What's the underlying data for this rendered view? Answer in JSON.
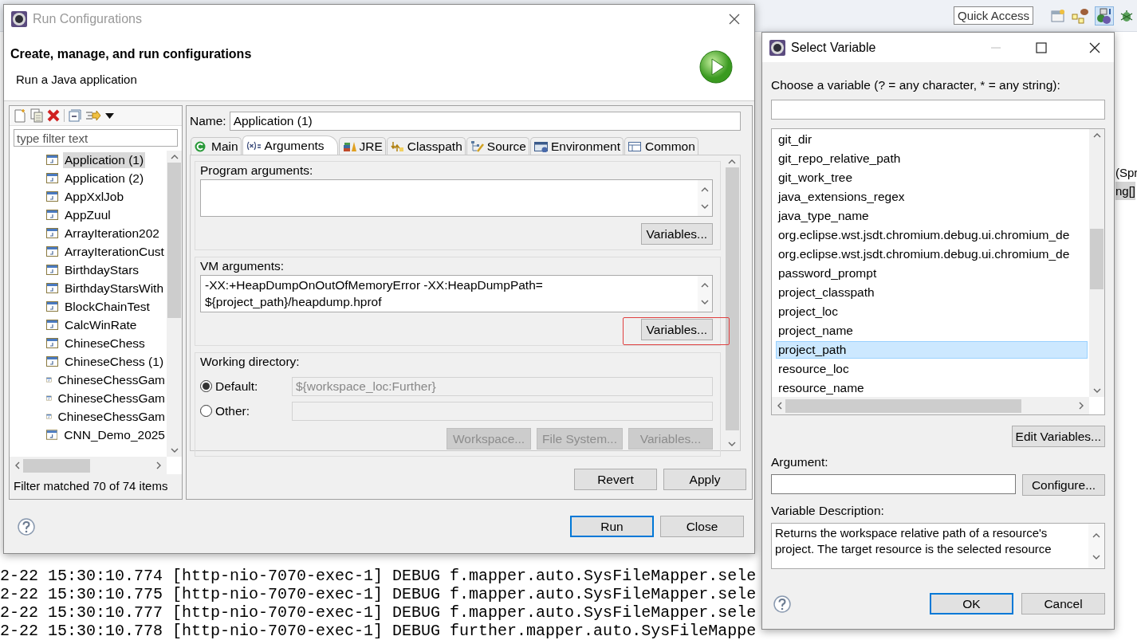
{
  "ide": {
    "quick_access": "Quick Access",
    "editor_fragments": [
      {
        "text": "(Spr",
        "selected": false
      },
      {
        "text": "ng[]",
        "selected": true
      }
    ],
    "console_lines": [
      "2-22 15:30:10.774 [http-nio-7070-exec-1] DEBUG f.mapper.auto.SysFileMapper.sele",
      "2-22 15:30:10.775 [http-nio-7070-exec-1] DEBUG f.mapper.auto.SysFileMapper.sele",
      "2-22 15:30:10.777 [http-nio-7070-exec-1] DEBUG f.mapper.auto.SysFileMapper.sele",
      "2-22 15:30:10.778 [http-nio-7070-exec-1] DEBUG further.mapper.auto.SysFileMappe"
    ]
  },
  "run_dialog": {
    "title": "Run Configurations",
    "heading": "Create, manage, and run configurations",
    "subtitle": "Run a Java application",
    "filter": {
      "placeholder": "type filter text"
    },
    "configs": [
      {
        "label": "Application (1)",
        "selected": true
      },
      {
        "label": "Application (2)",
        "selected": false
      },
      {
        "label": "AppXxlJob",
        "selected": false
      },
      {
        "label": "AppZuul",
        "selected": false
      },
      {
        "label": "ArrayIteration202",
        "selected": false
      },
      {
        "label": "ArrayIterationCust",
        "selected": false
      },
      {
        "label": "BirthdayStars",
        "selected": false
      },
      {
        "label": "BirthdayStarsWith",
        "selected": false
      },
      {
        "label": "BlockChainTest",
        "selected": false
      },
      {
        "label": "CalcWinRate",
        "selected": false
      },
      {
        "label": "ChineseChess",
        "selected": false
      },
      {
        "label": "ChineseChess (1)",
        "selected": false
      },
      {
        "label": "ChineseChessGam",
        "selected": false
      },
      {
        "label": "ChineseChessGam",
        "selected": false
      },
      {
        "label": "ChineseChessGam",
        "selected": false
      },
      {
        "label": "CNN_Demo_2025",
        "selected": false
      }
    ],
    "filter_status": "Filter matched 70 of 74 items",
    "name_label": "Name:",
    "name_value": "Application (1)",
    "tabs": [
      {
        "label": "Main",
        "kind": "main",
        "selected": false
      },
      {
        "label": "Arguments",
        "kind": "arguments",
        "selected": true
      },
      {
        "label": "JRE",
        "kind": "jre",
        "selected": false
      },
      {
        "label": "Classpath",
        "kind": "classpath",
        "selected": false
      },
      {
        "label": "Source",
        "kind": "source",
        "selected": false
      },
      {
        "label": "Environment",
        "kind": "environment",
        "selected": false
      },
      {
        "label": "Common",
        "kind": "common",
        "selected": false
      }
    ],
    "program_arguments": {
      "label": "Program arguments:",
      "button": {
        "label": "Variables...",
        "highlighted": false
      }
    },
    "vm_arguments": {
      "label": "VM arguments:",
      "value_lines": [
        "-XX:+HeapDumpOnOutOfMemoryError -XX:HeapDumpPath=",
        "${project_path}/heapdump.hprof"
      ],
      "button": {
        "label": "Variables...",
        "highlighted": true
      }
    },
    "working_directory": {
      "label": "Working directory:",
      "options": [
        {
          "label": "Default:",
          "selected": true,
          "value": "${workspace_loc:Further}"
        },
        {
          "label": "Other:",
          "selected": false
        }
      ],
      "buttons": [
        {
          "label": "Workspace...",
          "disabled": true
        },
        {
          "label": "File System...",
          "disabled": true
        },
        {
          "label": "Variables...",
          "disabled": true
        }
      ]
    },
    "actions": [
      {
        "label": "Revert",
        "default": false
      },
      {
        "label": "Apply",
        "default": false
      }
    ],
    "footer_buttons": [
      {
        "label": "Run",
        "default": true
      },
      {
        "label": "Close",
        "default": false
      }
    ]
  },
  "select_dialog": {
    "title": "Select Variable",
    "prompt": "Choose a variable (? = any character, * = any string):",
    "variables": [
      {
        "label": "git_dir",
        "selected": false
      },
      {
        "label": "git_repo_relative_path",
        "selected": false
      },
      {
        "label": "git_work_tree",
        "selected": false
      },
      {
        "label": "java_extensions_regex",
        "selected": false
      },
      {
        "label": "java_type_name",
        "selected": false
      },
      {
        "label": "org.eclipse.wst.jsdt.chromium.debug.ui.chromium_de",
        "selected": false
      },
      {
        "label": "org.eclipse.wst.jsdt.chromium.debug.ui.chromium_de",
        "selected": false
      },
      {
        "label": "password_prompt",
        "selected": false
      },
      {
        "label": "project_classpath",
        "selected": false
      },
      {
        "label": "project_loc",
        "selected": false
      },
      {
        "label": "project_name",
        "selected": false
      },
      {
        "label": "project_path",
        "selected": true
      },
      {
        "label": "resource_loc",
        "selected": false
      },
      {
        "label": "resource_name",
        "selected": false
      }
    ],
    "edit_button": "Edit Variables...",
    "argument_label": "Argument:",
    "configure_button": "Configure...",
    "description_label": "Variable Description:",
    "description": "Returns the workspace relative path of a resource's project. The target resource is the selected resource",
    "buttons": [
      {
        "label": "OK",
        "default": true
      },
      {
        "label": "Cancel",
        "default": false
      }
    ]
  }
}
